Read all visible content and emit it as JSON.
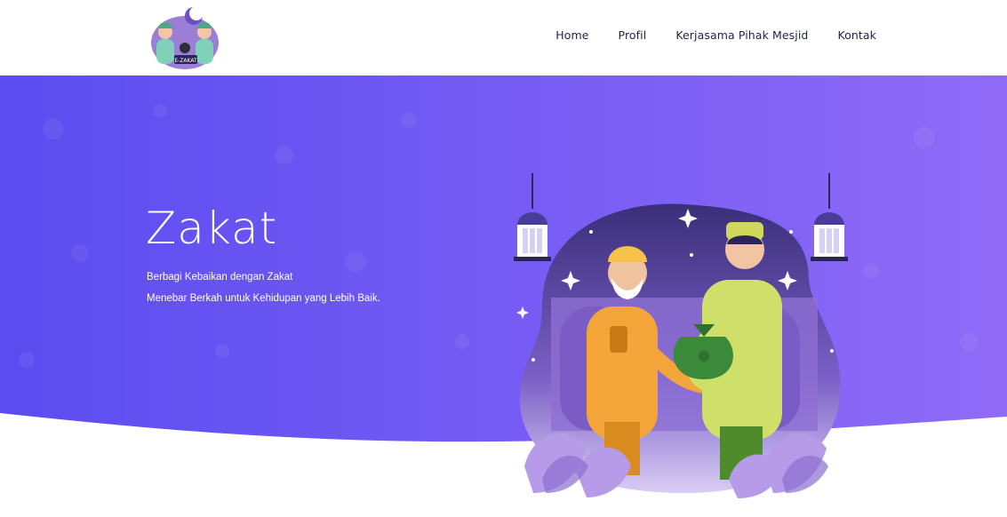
{
  "nav": {
    "items": [
      {
        "label": "Home"
      },
      {
        "label": "Profil"
      },
      {
        "label": "Kerjasama Pihak Mesjid"
      },
      {
        "label": "Kontak"
      }
    ]
  },
  "logo": {
    "text": "E-ZAKAT"
  },
  "hero": {
    "title": "Zakat",
    "line1": "Berbagi Kebaikan dengan Zakat",
    "line2": "Menebar Berkah untuk Kehidupan yang Lebih Baik."
  },
  "colors": {
    "hero_start": "#5b4cf0",
    "hero_end": "#8f6bf7",
    "nav_text": "#1f2440",
    "accent_lavender": "#b79be8"
  }
}
